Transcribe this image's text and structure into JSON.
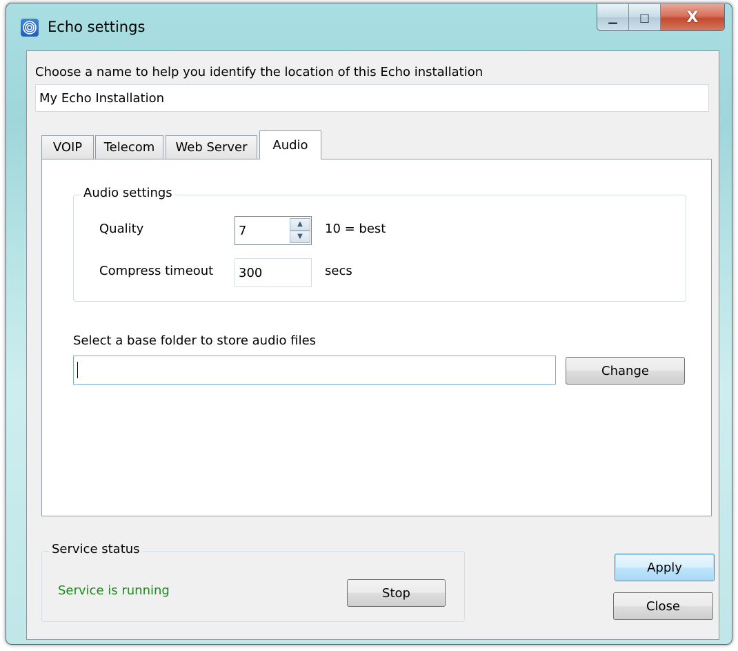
{
  "window": {
    "title": "Echo settings",
    "caption": {
      "minimize": "▁",
      "maximize": "□",
      "close": "X"
    }
  },
  "installation": {
    "prompt": "Choose a name to help you identify the location of this Echo installation",
    "name_value": "My Echo Installation"
  },
  "tabs": [
    {
      "label": "VOIP"
    },
    {
      "label": "Telecom"
    },
    {
      "label": "Web Server"
    },
    {
      "label": "Audio"
    }
  ],
  "active_tab": "Audio",
  "audio": {
    "group_title": "Audio settings",
    "quality_label": "Quality",
    "quality_value": "7",
    "quality_hint": "10 = best",
    "timeout_label": "Compress timeout",
    "timeout_value": "300",
    "timeout_unit": "secs",
    "folder_prompt": "Select a base folder to store audio files",
    "folder_value": "",
    "change_label": "Change"
  },
  "service": {
    "group_title": "Service status",
    "status_text": "Service is running",
    "status_color": "#1a8a1a",
    "stop_label": "Stop"
  },
  "footer": {
    "apply_label": "Apply",
    "close_label": "Close"
  },
  "icons": {
    "app": "echo-app-icon",
    "spin_up": "▲",
    "spin_down": "▼"
  }
}
